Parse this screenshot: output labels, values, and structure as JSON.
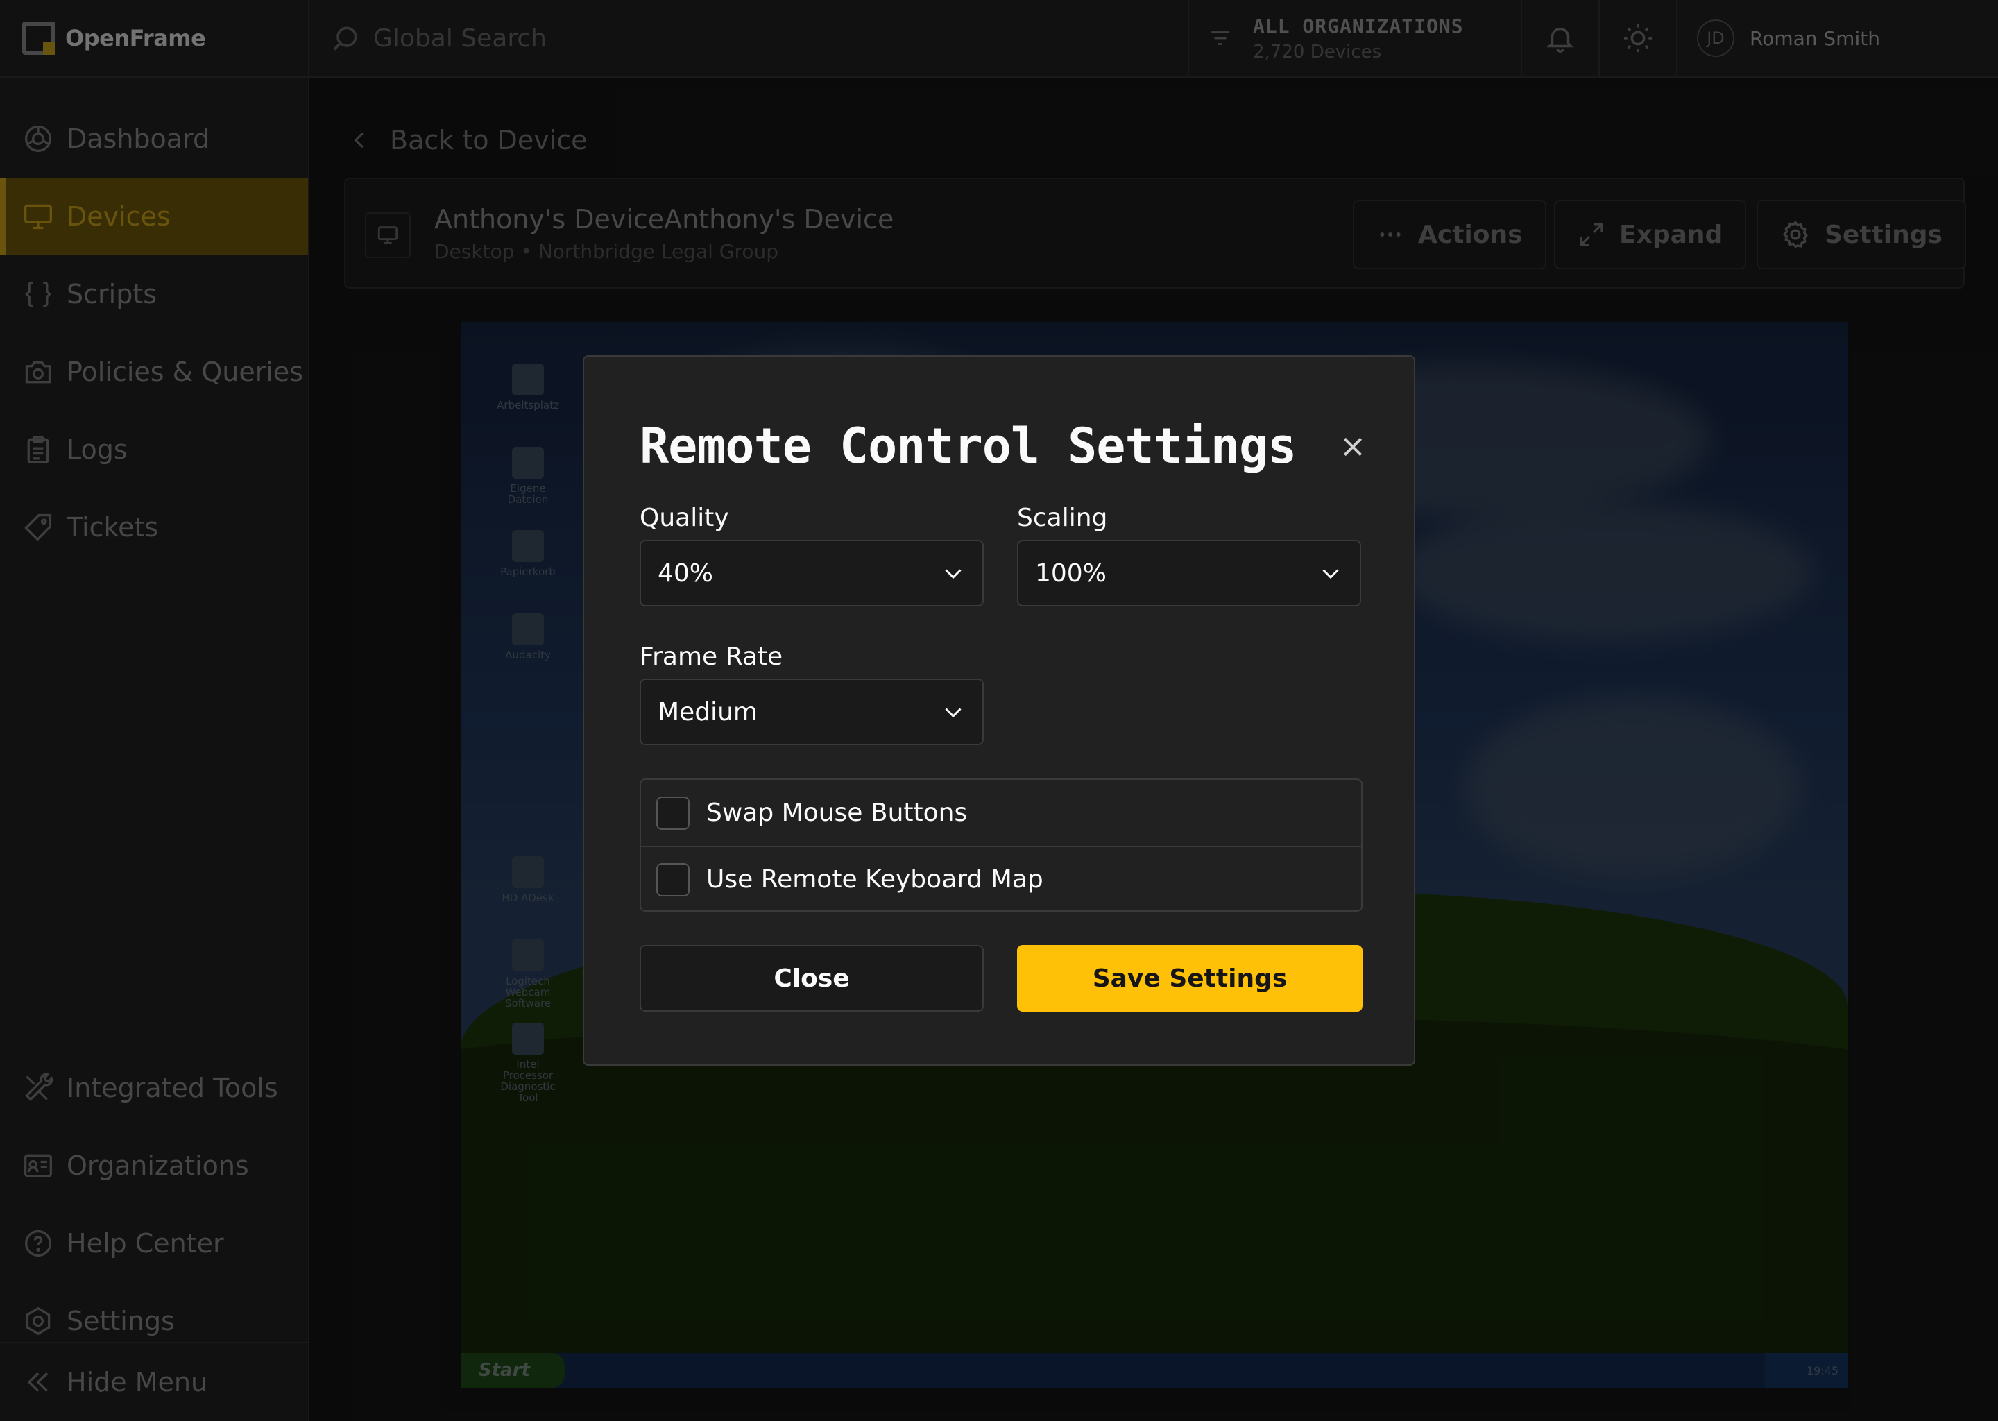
{
  "brand": {
    "name": "OpenFrame",
    "accent": "#ffc008"
  },
  "header": {
    "search_placeholder": "Global Search",
    "org_filter": {
      "title": "ALL ORGANIZATIONS",
      "subtitle": "2,720 Devices"
    },
    "user": {
      "initials": "JD",
      "name": "Roman Smith"
    },
    "icons": [
      "search-icon",
      "filter-icon",
      "bell-icon",
      "sun-icon"
    ]
  },
  "sidebar": {
    "items": [
      {
        "label": "Dashboard",
        "icon": "dashboard-icon"
      },
      {
        "label": "Devices",
        "icon": "monitor-icon",
        "active": true
      },
      {
        "label": "Scripts",
        "icon": "braces-icon"
      },
      {
        "label": "Policies & Queries",
        "icon": "camera-icon"
      },
      {
        "label": "Logs",
        "icon": "clipboard-icon"
      },
      {
        "label": "Tickets",
        "icon": "tag-icon"
      }
    ],
    "bottom_items": [
      {
        "label": "Integrated Tools",
        "icon": "tools-icon"
      },
      {
        "label": "Organizations",
        "icon": "id-card-icon"
      },
      {
        "label": "Help Center",
        "icon": "help-icon"
      },
      {
        "label": "Settings",
        "icon": "gear-icon"
      }
    ],
    "hide_menu": "Hide Menu"
  },
  "device": {
    "back_label": "Back to Device",
    "name": "Anthony's DeviceAnthony's Device",
    "subtitle": "Desktop • Northbridge Legal Group",
    "actions": {
      "actions_label": "Actions",
      "expand_label": "Expand",
      "settings_label": "Settings"
    }
  },
  "remote_desktop": {
    "icons": [
      {
        "label": "Arbeitsplatz"
      },
      {
        "label": "Eigene Dateien"
      },
      {
        "label": "Papierkorb"
      },
      {
        "label": "Audacity"
      },
      {
        "label": "HD ADesk"
      },
      {
        "label": "Logitech Webcam Software"
      },
      {
        "label": "Intel Processor Diagnostic Tool"
      }
    ],
    "start_label": "Start",
    "clock": "19:45"
  },
  "modal": {
    "title": "Remote Control Settings",
    "quality": {
      "label": "Quality",
      "value": "40%"
    },
    "scaling": {
      "label": "Scaling",
      "value": "100%"
    },
    "frame_rate": {
      "label": "Frame Rate",
      "value": "Medium"
    },
    "checkboxes": [
      {
        "label": "Swap Mouse Buttons",
        "checked": false
      },
      {
        "label": "Use Remote Keyboard Map",
        "checked": false
      }
    ],
    "close_label": "Close",
    "save_label": "Save Settings"
  }
}
